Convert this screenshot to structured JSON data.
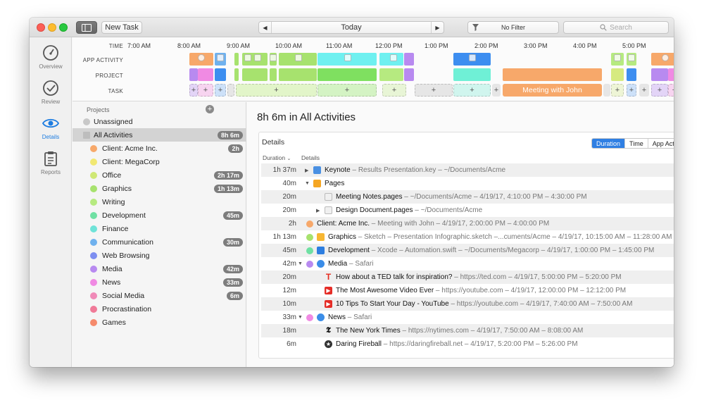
{
  "toolbar": {
    "new_task": "New Task",
    "date": "Today",
    "filter": "No Filter",
    "search_placeholder": "Search"
  },
  "nav": [
    {
      "label": "Overview",
      "icon": "gauge-icon"
    },
    {
      "label": "Review",
      "icon": "checkmark-circle-icon"
    },
    {
      "label": "Details",
      "icon": "eye-icon"
    },
    {
      "label": "Reports",
      "icon": "clipboard-icon"
    }
  ],
  "timeline": {
    "row_labels": [
      "TIME",
      "APP ACTIVITY",
      "PROJECT",
      "TASK"
    ],
    "hours": [
      "7:00 AM",
      "8:00 AM",
      "9:00 AM",
      "10:00 AM",
      "11:00 AM",
      "12:00 PM",
      "1:00 PM",
      "2:00 PM",
      "3:00 PM",
      "4:00 PM",
      "5:00 PM"
    ],
    "task_plus": "+",
    "task_meeting": "Meeting with John"
  },
  "projects": {
    "header": "Projects",
    "add": "+",
    "items": [
      {
        "name": "Unassigned",
        "color": "#c8c8c8",
        "badge": ""
      },
      {
        "name": "All Activities",
        "color": "",
        "badge": "8h 6m"
      },
      {
        "name": "Client: Acme Inc.",
        "color": "#f7a86a",
        "badge": "2h"
      },
      {
        "name": "Client: MegaCorp",
        "color": "#f1e872",
        "badge": ""
      },
      {
        "name": "Office",
        "color": "#cfe875",
        "badge": "2h 17m"
      },
      {
        "name": "Graphics",
        "color": "#a7e26e",
        "badge": "1h 13m"
      },
      {
        "name": "Writing",
        "color": "#b6ea80",
        "badge": ""
      },
      {
        "name": "Development",
        "color": "#6fe0a3",
        "badge": "45m"
      },
      {
        "name": "Finance",
        "color": "#6fe3d8",
        "badge": ""
      },
      {
        "name": "Communication",
        "color": "#6fb1ee",
        "badge": "30m"
      },
      {
        "name": "Web Browsing",
        "color": "#7d8ef0",
        "badge": ""
      },
      {
        "name": "Media",
        "color": "#b88af0",
        "badge": "42m"
      },
      {
        "name": "News",
        "color": "#f08ae3",
        "badge": "33m"
      },
      {
        "name": "Social Media",
        "color": "#f08ab8",
        "badge": "6m"
      },
      {
        "name": "Procrastination",
        "color": "#f07a98",
        "badge": ""
      },
      {
        "name": "Games",
        "color": "#f58a6c",
        "badge": ""
      }
    ]
  },
  "detail": {
    "title": "8h 6m in All Activities",
    "panel_title": "Details",
    "segments": [
      "Duration",
      "Time",
      "App Activity"
    ],
    "col_duration": "Duration",
    "col_details": "Details",
    "rows": [
      {
        "dur": "1h 37m",
        "main": "Keynote",
        "sub": " – Results Presentation.key – ~/Documents/Acme",
        "icon": "keynote-icon",
        "indent": 1,
        "tri": "right",
        "dot": ""
      },
      {
        "dur": "40m",
        "main": "Pages",
        "sub": "",
        "icon": "pages-icon",
        "indent": 1,
        "tri": "down",
        "dot": ""
      },
      {
        "dur": "20m",
        "main": "Meeting Notes.pages",
        "sub": " – ~/Documents/Acme – 4/19/17, 4:10:00 PM – 4:30:00 PM",
        "icon": "pages-doc-icon",
        "indent": 2,
        "tri": "",
        "dot": ""
      },
      {
        "dur": "20m",
        "main": "Design Document.pages",
        "sub": " – ~/Documents/Acme",
        "icon": "pages-doc-icon",
        "indent": 2,
        "tri": "right",
        "dot": ""
      },
      {
        "dur": "2h",
        "main": "Client: Acme Inc.",
        "sub": " – Meeting with John – 4/19/17, 2:00:00 PM – 4:00:00 PM",
        "icon": "",
        "indent": 0,
        "tri": "",
        "dot": "#f7a86a"
      },
      {
        "dur": "1h 13m",
        "main": "Graphics",
        "sub": " – Sketch – Presentation Infographic.sketch –...cuments/Acme – 4/19/17, 10:15:00 AM – 11:28:00 AM",
        "icon": "sketch-icon",
        "indent": 0,
        "tri": "",
        "dot": "#a7e26e"
      },
      {
        "dur": "45m",
        "main": "Development",
        "sub": " – Xcode – Automation.swift – ~/Documents/Megacorp – 4/19/17, 1:00:00 PM – 1:45:00 PM",
        "icon": "xcode-icon",
        "indent": 0,
        "tri": "",
        "dot": "#6fe0a3"
      },
      {
        "dur": "42m",
        "main": "Media",
        "sub": " – Safari",
        "icon": "safari-icon",
        "indent": 0,
        "tri": "down",
        "dot": "#b88af0"
      },
      {
        "dur": "20m",
        "main": "How about a TED talk for inspiration?",
        "sub": " – https://ted.com – 4/19/17, 5:00:00 PM – 5:20:00 PM",
        "icon": "ted-icon",
        "indent": 2,
        "tri": "",
        "dot": ""
      },
      {
        "dur": "12m",
        "main": "The Most Awesome Video Ever",
        "sub": " – https://youtube.com – 4/19/17, 12:00:00 PM – 12:12:00 PM",
        "icon": "youtube-icon",
        "indent": 2,
        "tri": "",
        "dot": ""
      },
      {
        "dur": "10m",
        "main": "10 Tips To Start Your Day - YouTube",
        "sub": " – https://youtube.com – 4/19/17, 7:40:00 AM – 7:50:00 AM",
        "icon": "youtube-icon",
        "indent": 2,
        "tri": "",
        "dot": ""
      },
      {
        "dur": "33m",
        "main": "News",
        "sub": " – Safari",
        "icon": "safari-icon",
        "indent": 0,
        "tri": "down",
        "dot": "#f08ae3"
      },
      {
        "dur": "18m",
        "main": "The New York Times",
        "sub": " – https://nytimes.com – 4/19/17, 7:50:00 AM – 8:08:00 AM",
        "icon": "nytimes-icon",
        "indent": 2,
        "tri": "",
        "dot": ""
      },
      {
        "dur": "6m",
        "main": "Daring Fireball",
        "sub": " – https://daringfireball.net – 4/19/17, 5:20:00 PM – 5:26:00 PM",
        "icon": "daring-fireball-icon",
        "indent": 2,
        "tri": "",
        "dot": ""
      }
    ]
  }
}
